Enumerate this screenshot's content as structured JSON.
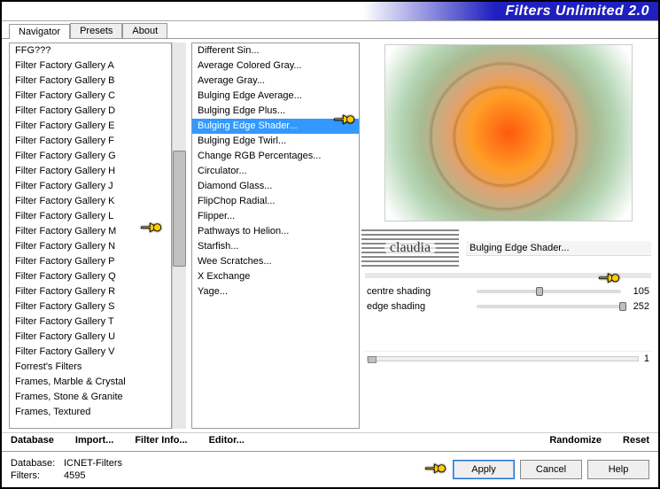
{
  "title": "Filters Unlimited 2.0",
  "tabs": [
    {
      "label": "Navigator",
      "active": true
    },
    {
      "label": "Presets",
      "active": false
    },
    {
      "label": "About",
      "active": false
    }
  ],
  "categories": [
    "FFG???",
    "Filter Factory Gallery A",
    "Filter Factory Gallery B",
    "Filter Factory Gallery C",
    "Filter Factory Gallery D",
    "Filter Factory Gallery E",
    "Filter Factory Gallery F",
    "Filter Factory Gallery G",
    "Filter Factory Gallery H",
    "Filter Factory Gallery J",
    "Filter Factory Gallery K",
    "Filter Factory Gallery L",
    "Filter Factory Gallery M",
    "Filter Factory Gallery N",
    "Filter Factory Gallery P",
    "Filter Factory Gallery Q",
    "Filter Factory Gallery R",
    "Filter Factory Gallery S",
    "Filter Factory Gallery T",
    "Filter Factory Gallery U",
    "Filter Factory Gallery V",
    "Forrest's Filters",
    "Frames, Marble & Crystal",
    "Frames, Stone & Granite",
    "Frames, Textured"
  ],
  "selected_category_index": 13,
  "filters": [
    "Different Sin...",
    "Average Colored Gray...",
    "Average Gray...",
    "Bulging Edge Average...",
    "Bulging Edge Plus...",
    "Bulging Edge Shader...",
    "Bulging Edge Twirl...",
    "Change RGB Percentages...",
    "Circulator...",
    "Diamond Glass...",
    "FlipChop Radial...",
    "Flipper...",
    "Pathways to Helion...",
    "Starfish...",
    "Wee Scratches...",
    "X Exchange",
    "Yage..."
  ],
  "selected_filter_index": 5,
  "watermark": "claudia",
  "current_filter_name": "Bulging Edge Shader...",
  "params": [
    {
      "label": "centre shading",
      "value": 105,
      "pct": 41
    },
    {
      "label": "edge shading",
      "value": 252,
      "pct": 99
    }
  ],
  "page_indicator": "1",
  "link_actions": {
    "database": "Database",
    "import": "Import...",
    "filter_info": "Filter Info...",
    "editor": "Editor...",
    "randomize": "Randomize",
    "reset": "Reset"
  },
  "footer": {
    "db_label": "Database:",
    "db_value": "ICNET-Filters",
    "filters_label": "Filters:",
    "filters_value": "4595"
  },
  "buttons": {
    "apply": "Apply",
    "cancel": "Cancel",
    "help": "Help"
  }
}
